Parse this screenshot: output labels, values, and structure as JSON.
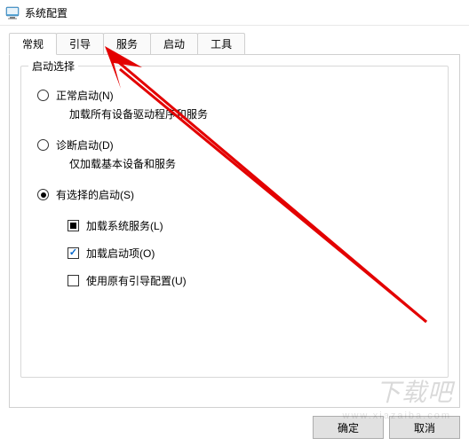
{
  "window": {
    "title": "系统配置"
  },
  "tabs": {
    "t0": "常规",
    "t1": "引导",
    "t2": "服务",
    "t3": "启动",
    "t4": "工具"
  },
  "groupbox": {
    "title": "启动选择"
  },
  "options": {
    "normal": {
      "label": "正常启动(N)",
      "desc": "加载所有设备驱动程序和服务"
    },
    "diagnostic": {
      "label": "诊断启动(D)",
      "desc": "仅加载基本设备和服务"
    },
    "selective": {
      "label": "有选择的启动(S)"
    }
  },
  "checks": {
    "load_services": "加载系统服务(L)",
    "load_startup": "加载启动项(O)",
    "use_original_boot": "使用原有引导配置(U)"
  },
  "buttons": {
    "ok": "确定",
    "cancel": "取消"
  },
  "watermark": {
    "main": "下载吧",
    "sub": "www.xiazaiba.com"
  }
}
